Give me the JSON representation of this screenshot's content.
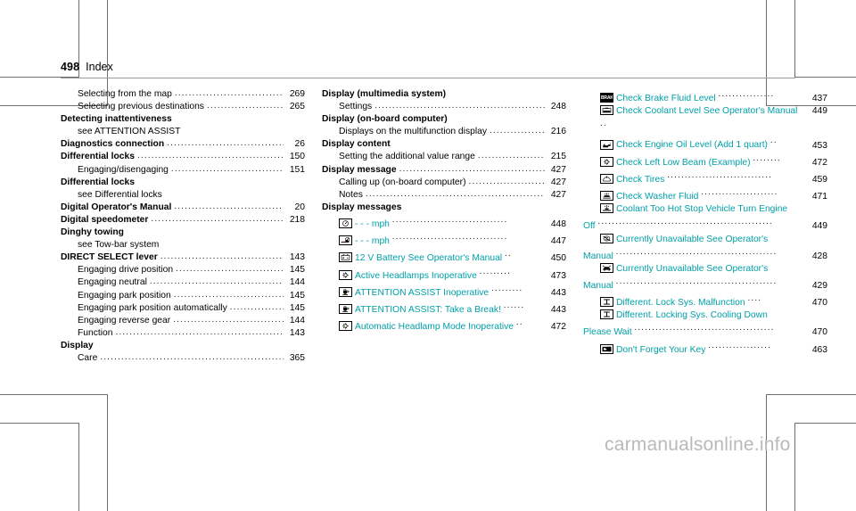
{
  "header": {
    "page_number": "498",
    "section": "Index"
  },
  "watermark": "carmanualsonline.info",
  "colors": {
    "link_teal": "#00a0a8",
    "text_black": "#000000",
    "rule_gray": "#9a9a9a",
    "watermark_gray": "#b9b9b9"
  },
  "columns": [
    {
      "id": "column-1",
      "entries": [
        {
          "kind": "sub",
          "label": "Selecting from the map",
          "page": "269"
        },
        {
          "kind": "sub",
          "label": "Selecting previous destinations",
          "page": "265"
        },
        {
          "kind": "main",
          "label": "Detecting inattentiveness",
          "page": ""
        },
        {
          "kind": "see",
          "label": "see ATTENTION ASSIST"
        },
        {
          "kind": "main",
          "label": "Diagnostics connection",
          "page": "26"
        },
        {
          "kind": "main",
          "label": "Differential locks",
          "page": "150"
        },
        {
          "kind": "sub",
          "label": "Engaging/disengaging",
          "page": "151"
        },
        {
          "kind": "main",
          "label": "Differential locks",
          "page": ""
        },
        {
          "kind": "see",
          "label": "see Differential locks"
        },
        {
          "kind": "main",
          "label": "Digital Operator's Manual",
          "page": "20"
        },
        {
          "kind": "main",
          "label": "Digital speedometer",
          "page": "218"
        },
        {
          "kind": "main",
          "label": "Dinghy towing",
          "page": ""
        },
        {
          "kind": "see",
          "label": "see Tow-bar system"
        },
        {
          "kind": "main",
          "label": "DIRECT SELECT lever",
          "page": "143"
        },
        {
          "kind": "sub",
          "label": "Engaging drive position",
          "page": "145"
        },
        {
          "kind": "sub",
          "label": "Engaging neutral",
          "page": "144"
        },
        {
          "kind": "sub",
          "label": "Engaging park position",
          "page": "145"
        },
        {
          "kind": "sub",
          "label": "Engaging park position automatically",
          "page": "145"
        },
        {
          "kind": "sub",
          "label": "Engaging reverse gear",
          "page": "144"
        },
        {
          "kind": "sub",
          "label": "Function",
          "page": "143"
        },
        {
          "kind": "main",
          "label": "Display",
          "page": ""
        },
        {
          "kind": "sub",
          "label": "Care",
          "page": "365"
        }
      ]
    },
    {
      "id": "column-2",
      "entries": [
        {
          "kind": "main",
          "label": "Display (multimedia system)",
          "page": ""
        },
        {
          "kind": "sub",
          "label": "Settings",
          "page": "248"
        },
        {
          "kind": "main",
          "label": "Display (on-board computer)",
          "page": ""
        },
        {
          "kind": "sub",
          "label": "Displays on the multifunction display",
          "page": "216"
        },
        {
          "kind": "main",
          "label": "Display content",
          "page": ""
        },
        {
          "kind": "sub",
          "label": "Setting the additional value range",
          "page": "215"
        },
        {
          "kind": "main",
          "label": "Display message",
          "page": "427"
        },
        {
          "kind": "sub",
          "label": "Calling up (on-board computer)",
          "page": "427"
        },
        {
          "kind": "sub",
          "label": "Notes",
          "page": "427"
        },
        {
          "kind": "main",
          "label": "Display messages",
          "page": ""
        },
        {
          "kind": "msg",
          "icon": "speedometer-icon",
          "label": "- - - mph",
          "page": "448",
          "wrap": false
        },
        {
          "kind": "msg",
          "icon": "car-speed-icon",
          "label": "- - - mph",
          "page": "447",
          "wrap": false
        },
        {
          "kind": "msg",
          "icon": "battery-icon",
          "label": "12 V Battery See Operator's Manual",
          "page": "450",
          "wrap": true
        },
        {
          "kind": "msg",
          "icon": "headlamp-icon",
          "label": "Active Headlamps Inoperative",
          "page": "473",
          "wrap": false
        },
        {
          "kind": "msg",
          "icon": "attention-assist-icon",
          "label": "ATTENTION ASSIST Inoperative",
          "page": "443",
          "wrap": true
        },
        {
          "kind": "msg",
          "icon": "attention-assist-icon",
          "label": "ATTENTION ASSIST: Take a Break!",
          "page": "443",
          "wrap": true
        },
        {
          "kind": "msg",
          "icon": "headlamp-icon",
          "label": "Automatic Headlamp Mode Inoperative",
          "page": "472",
          "wrap": true
        }
      ]
    },
    {
      "id": "column-3",
      "entries": [
        {
          "kind": "msg",
          "icon": "brake-icon",
          "label": "Check Brake Fluid Level",
          "page": "437",
          "wrap": false
        },
        {
          "kind": "msg",
          "icon": "coolant-level-icon",
          "label": "Check Coolant Level See Operator's Manual",
          "page": "449",
          "wrap": true
        },
        {
          "kind": "msg",
          "icon": "oil-can-icon",
          "label": "Check Engine Oil Level (Add 1 quart)",
          "page": "453",
          "wrap": true
        },
        {
          "kind": "msg",
          "icon": "headlamp-icon",
          "label": "Check Left Low Beam (Example)",
          "page": "472",
          "wrap": true
        },
        {
          "kind": "msg",
          "icon": "tire-pressure-icon",
          "label": "Check Tires",
          "page": "459",
          "wrap": false
        },
        {
          "kind": "msg",
          "icon": "washer-fluid-icon",
          "label": "Check Washer Fluid",
          "page": "471",
          "wrap": false
        },
        {
          "kind": "msg",
          "icon": "coolant-temp-icon",
          "label": "Coolant Too Hot Stop Vehicle Turn Engine Off",
          "page": "449",
          "wrap": true
        },
        {
          "kind": "msg",
          "icon": "esp-off-icon",
          "label": "Currently Unavailable See Operator's Manual",
          "page": "428",
          "wrap": true
        },
        {
          "kind": "msg",
          "icon": "car-assist-icon",
          "label": "Currently Unavailable See Operator's Manual",
          "page": "429",
          "wrap": true
        },
        {
          "kind": "msg",
          "icon": "diff-lock-icon",
          "label": "Different. Lock Sys. Malfunction",
          "page": "470",
          "wrap": true
        },
        {
          "kind": "msg",
          "icon": "diff-lock-icon",
          "label": "Different. Locking Sys. Cooling Down Please Wait",
          "page": "470",
          "wrap": true
        },
        {
          "kind": "msg",
          "icon": "key-icon",
          "label": "Don't Forget Your Key",
          "page": "463",
          "wrap": false
        }
      ]
    }
  ]
}
